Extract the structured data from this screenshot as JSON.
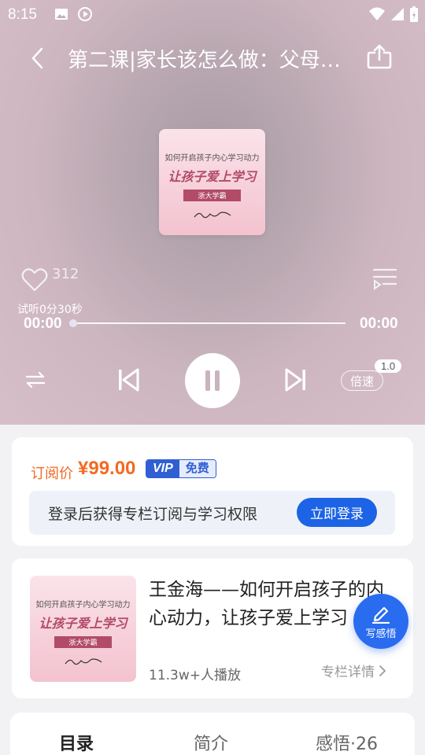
{
  "status_bar": {
    "time": "8:15",
    "left_icons": [
      "image-icon",
      "play-circle-icon"
    ],
    "right_icons": [
      "wifi-icon",
      "signal-icon",
      "battery-icon"
    ]
  },
  "nav": {
    "title": "第二课|家长该怎么做：父母…"
  },
  "cover": {
    "line1": "如何开启孩子内心学习动力",
    "line2": "让孩子爱上学习",
    "tag": "浙大学霸"
  },
  "player": {
    "like_count": "312",
    "trial_label": "试听0分30秒",
    "current_time": "00:00",
    "total_time": "00:00",
    "progress": 0,
    "speed_label": "倍速",
    "speed_value": "1.0"
  },
  "price": {
    "label": "订阅价",
    "value": "¥99.00",
    "vip_text": "VIP",
    "vip_free": "免费",
    "login_prompt": "登录后获得专栏订阅与学习权限",
    "login_button": "立即登录"
  },
  "course": {
    "title": "王金海——如何开启孩子的内心动力，让孩子爱上学习",
    "plays": "11.3w+人播放",
    "detail_link": "专栏详情",
    "cover_line1": "如何开启孩子内心学习动力",
    "cover_line2": "让孩子爱上学习",
    "cover_tag": "浙大学霸"
  },
  "fab": {
    "label": "写感悟"
  },
  "tabs": [
    {
      "label": "目录",
      "active": true
    },
    {
      "label": "简介",
      "active": false
    },
    {
      "label": "感悟·26",
      "active": false
    }
  ],
  "colors": {
    "accent_blue": "#1d63e6",
    "price_orange": "#f36a22",
    "cover_pink": "#f6cfda"
  }
}
